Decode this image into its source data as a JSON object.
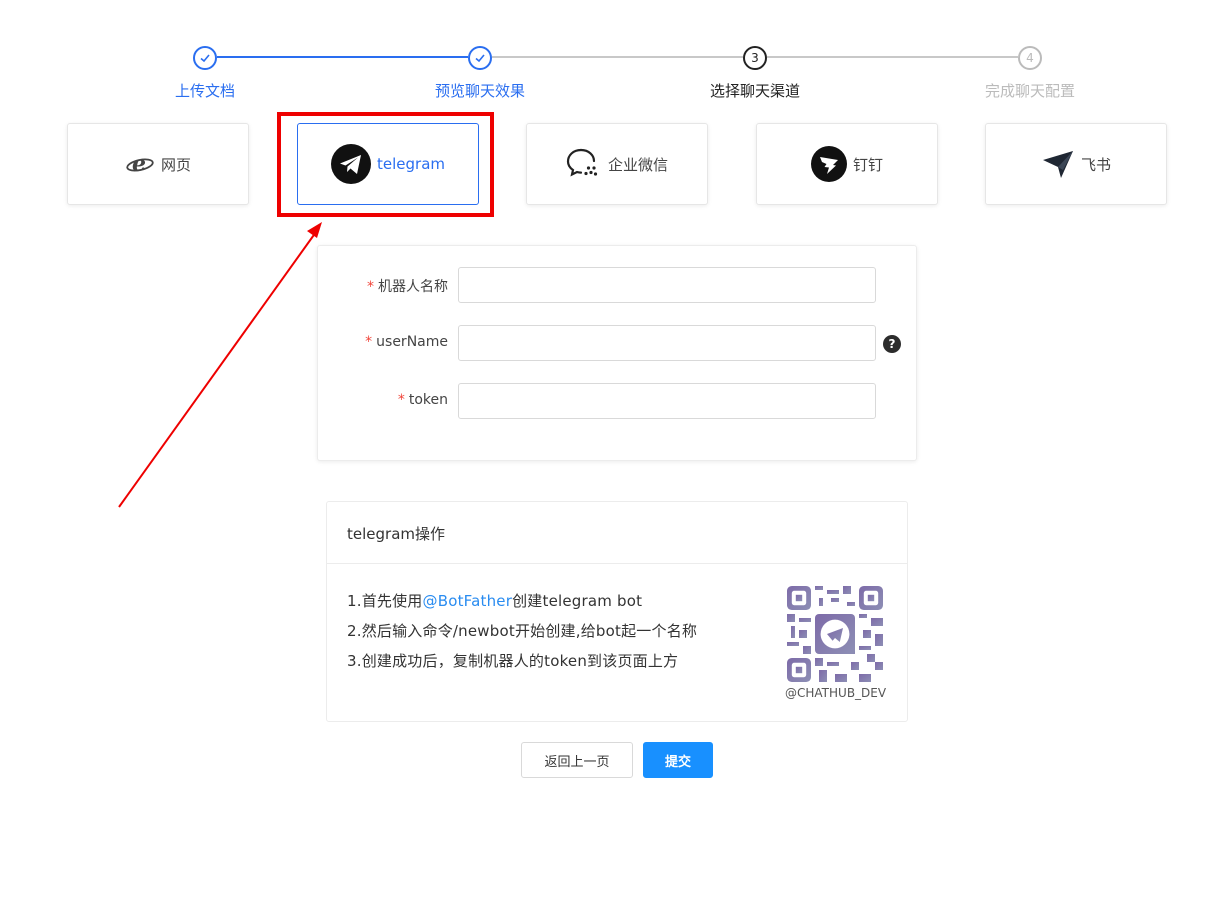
{
  "steps": [
    {
      "label": "上传文档",
      "status": "done"
    },
    {
      "label": "预览聊天效果",
      "status": "done"
    },
    {
      "label": "选择聊天渠道",
      "status": "current",
      "number": "3"
    },
    {
      "label": "完成聊天配置",
      "status": "todo",
      "number": "4"
    }
  ],
  "channels": [
    {
      "label": "网页",
      "icon": "ie-browser-icon"
    },
    {
      "label": "telegram",
      "icon": "telegram-icon",
      "selected": true
    },
    {
      "label": "企业微信",
      "icon": "wecom-icon"
    },
    {
      "label": "钉钉",
      "icon": "dingtalk-icon"
    },
    {
      "label": "飞书",
      "icon": "feishu-icon"
    }
  ],
  "form": {
    "required_mark": "*",
    "bot_name_label": "机器人名称",
    "bot_name_value": "",
    "username_label": "userName",
    "username_value": "",
    "token_label": "token",
    "token_value": "",
    "help_icon": "?"
  },
  "instructions": {
    "title": "telegram操作",
    "line1_prefix": "1.首先使用",
    "line1_link": "@BotFather",
    "line1_suffix": "创建telegram bot",
    "line2": "2.然后输入命令/newbot开始创建,给bot起一个名称",
    "line3": "3.创建成功后，复制机器人的token到该页面上方",
    "qr_caption": "@CHATHUB_DEV"
  },
  "buttons": {
    "back": "返回上一页",
    "submit": "提交"
  },
  "colors": {
    "primary": "#1890ff",
    "step_done": "#2a6ef0",
    "annotation": "#ee0000",
    "required": "#f0453a"
  }
}
